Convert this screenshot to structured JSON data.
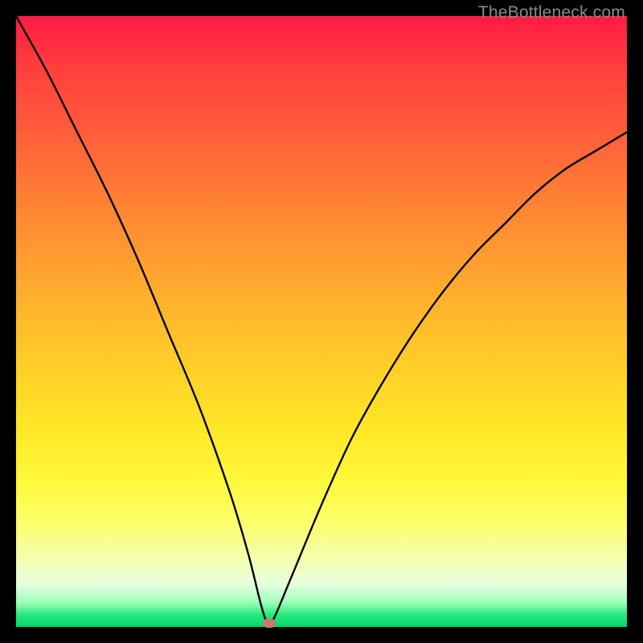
{
  "watermark": "TheBottleneck.com",
  "chart_data": {
    "type": "line",
    "title": "",
    "xlabel": "",
    "ylabel": "",
    "xlim": [
      0,
      100
    ],
    "ylim": [
      0,
      100
    ],
    "x": [
      0,
      5,
      10,
      15,
      20,
      25,
      30,
      35,
      38,
      40,
      41,
      42,
      45,
      50,
      55,
      60,
      65,
      70,
      75,
      80,
      85,
      90,
      95,
      100
    ],
    "values": [
      100,
      91,
      81,
      71,
      60,
      48,
      36,
      22,
      12,
      4,
      1,
      1,
      8,
      20,
      31,
      40,
      48,
      55,
      61,
      66,
      71,
      75,
      78,
      81
    ],
    "marker": {
      "x": 41.5,
      "y": 0.5
    },
    "gradient_stops": [
      {
        "pos": 0,
        "color": "#ff1a44"
      },
      {
        "pos": 50,
        "color": "#ffd028"
      },
      {
        "pos": 85,
        "color": "#fcff6a"
      },
      {
        "pos": 100,
        "color": "#00d66a"
      }
    ]
  }
}
